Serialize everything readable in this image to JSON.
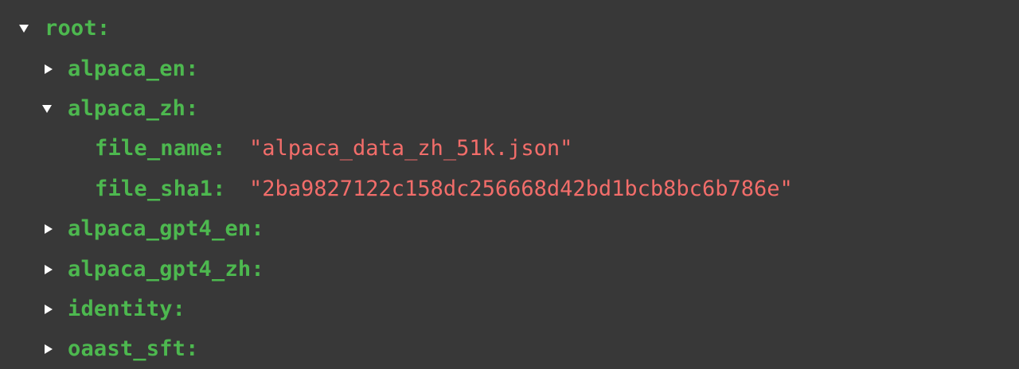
{
  "colors": {
    "background": "#383838",
    "key": "#4db84f",
    "string_value": "#f26d6a",
    "toggle": "#ffffff"
  },
  "tree": {
    "root": {
      "label": "root:",
      "expanded": true,
      "toggle_icon": "caret-down-icon"
    },
    "nodes": [
      {
        "label": "alpaca_en:",
        "expanded": false,
        "toggle_icon": "caret-right-icon"
      },
      {
        "label": "alpaca_zh:",
        "expanded": true,
        "toggle_icon": "caret-down-icon",
        "children": [
          {
            "key": "file_name:",
            "value": "\"alpaca_data_zh_51k.json\""
          },
          {
            "key": "file_sha1:",
            "value": "\"2ba9827122c158dc256668d42bd1bcb8bc6b786e\""
          }
        ]
      },
      {
        "label": "alpaca_gpt4_en:",
        "expanded": false,
        "toggle_icon": "caret-right-icon"
      },
      {
        "label": "alpaca_gpt4_zh:",
        "expanded": false,
        "toggle_icon": "caret-right-icon"
      },
      {
        "label": "identity:",
        "expanded": false,
        "toggle_icon": "caret-right-icon"
      },
      {
        "label": "oaast_sft:",
        "expanded": false,
        "toggle_icon": "caret-right-icon"
      }
    ]
  }
}
